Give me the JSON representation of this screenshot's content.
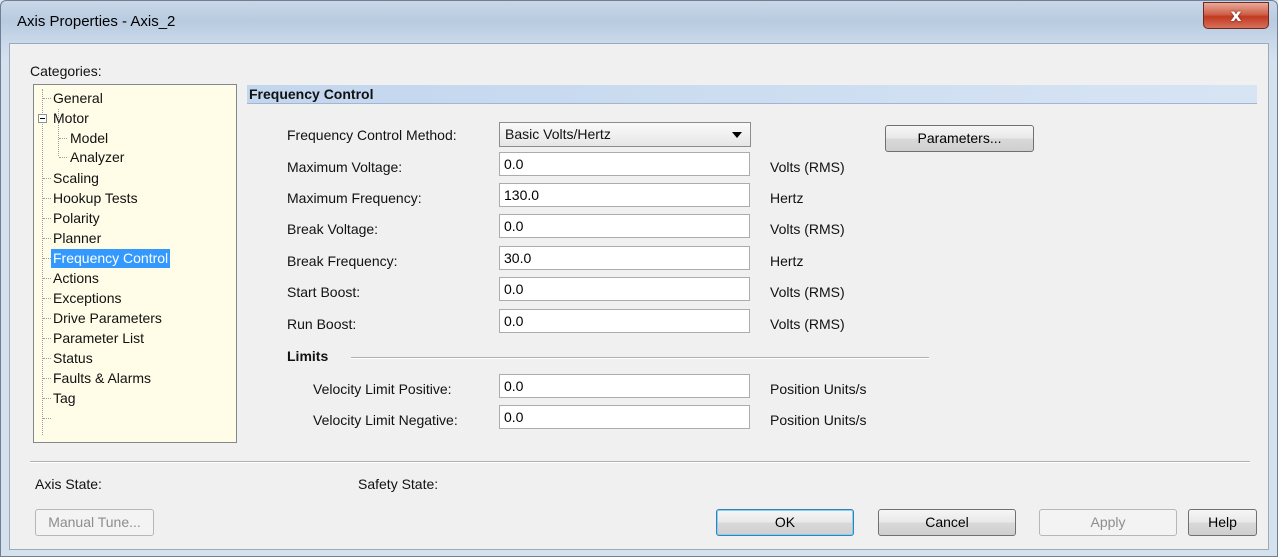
{
  "window": {
    "title": "Axis Properties - Axis_2",
    "close_glyph": "x"
  },
  "categories": {
    "label": "Categories:",
    "items": [
      {
        "label": "General"
      },
      {
        "label": "Motor"
      },
      {
        "label": "Model"
      },
      {
        "label": "Analyzer"
      },
      {
        "label": "Scaling"
      },
      {
        "label": "Hookup Tests"
      },
      {
        "label": "Polarity"
      },
      {
        "label": "Planner"
      },
      {
        "label": "Frequency Control"
      },
      {
        "label": "Actions"
      },
      {
        "label": "Exceptions"
      },
      {
        "label": "Drive Parameters"
      },
      {
        "label": "Parameter List"
      },
      {
        "label": "Status"
      },
      {
        "label": "Faults & Alarms"
      },
      {
        "label": "Tag"
      }
    ],
    "selected": "Frequency Control"
  },
  "section": {
    "title": "Frequency Control"
  },
  "method": {
    "label": "Frequency Control Method:",
    "value": "Basic Volts/Hertz"
  },
  "parameters_button": "Parameters...",
  "fields": [
    {
      "label": "Maximum Voltage:",
      "value": "0.0",
      "unit": "Volts (RMS)"
    },
    {
      "label": "Maximum Frequency:",
      "value": "130.0",
      "unit": "Hertz"
    },
    {
      "label": "Break Voltage:",
      "value": "0.0",
      "unit": "Volts (RMS)"
    },
    {
      "label": "Break Frequency:",
      "value": "30.0",
      "unit": "Hertz"
    },
    {
      "label": "Start Boost:",
      "value": "0.0",
      "unit": "Volts (RMS)"
    },
    {
      "label": "Run Boost:",
      "value": "0.0",
      "unit": "Volts (RMS)"
    }
  ],
  "limits": {
    "title": "Limits",
    "fields": [
      {
        "label": "Velocity Limit Positive:",
        "value": "0.0",
        "unit": "Position Units/s"
      },
      {
        "label": "Velocity Limit Negative:",
        "value": "0.0",
        "unit": "Position Units/s"
      }
    ]
  },
  "status": {
    "axis_state_label": "Axis State:",
    "safety_state_label": "Safety State:"
  },
  "buttons": {
    "manual_tune": "Manual Tune...",
    "ok": "OK",
    "cancel": "Cancel",
    "apply": "Apply",
    "help": "Help"
  },
  "colors": {
    "selection": "#3399ff",
    "tree_background": "#fffde8",
    "close_button": "#c23a22"
  }
}
